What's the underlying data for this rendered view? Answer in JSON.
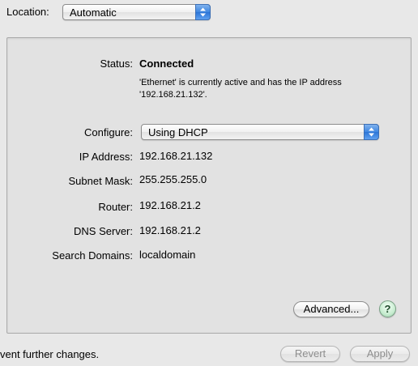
{
  "location": {
    "label": "Location:",
    "value": "Automatic"
  },
  "status": {
    "label": "Status:",
    "value": "Connected",
    "description_line1": "'Ethernet' is currently active and has the IP address",
    "description_line2": "'192.168.21.132'."
  },
  "configure": {
    "label": "Configure:",
    "value": "Using DHCP"
  },
  "fields": {
    "ip_address_label": "IP Address:",
    "ip_address_value": "192.168.21.132",
    "subnet_mask_label": "Subnet Mask:",
    "subnet_mask_value": "255.255.255.0",
    "router_label": "Router:",
    "router_value": "192.168.21.2",
    "dns_server_label": "DNS Server:",
    "dns_server_value": "192.168.21.2",
    "search_domains_label": "Search Domains:",
    "search_domains_value": "localdomain"
  },
  "buttons": {
    "advanced": "Advanced...",
    "help": "?",
    "revert": "Revert",
    "apply": "Apply"
  },
  "footer": {
    "lock_text": "vent further changes."
  },
  "icons": {
    "popup_arrows": "up-down-arrows-icon",
    "help": "help-icon"
  }
}
